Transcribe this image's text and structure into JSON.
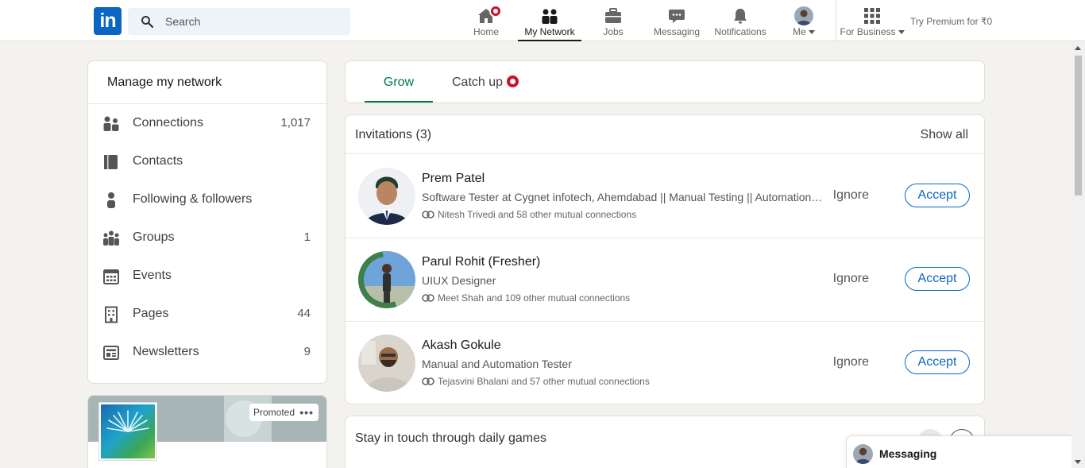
{
  "nav": {
    "logo": "in",
    "search_placeholder": "Search",
    "items": [
      {
        "label": "Home",
        "icon": "home-icon"
      },
      {
        "label": "My Network",
        "icon": "network-icon"
      },
      {
        "label": "Jobs",
        "icon": "briefcase-icon"
      },
      {
        "label": "Messaging",
        "icon": "chat-icon"
      },
      {
        "label": "Notifications",
        "icon": "bell-icon"
      },
      {
        "label": "Me",
        "icon": "avatar"
      },
      {
        "label": "For Business",
        "icon": "grid-icon"
      }
    ],
    "active": "My Network",
    "premium": "Try Premium for ₹0"
  },
  "network": {
    "title": "Manage my network",
    "items": [
      {
        "label": "Connections",
        "count": "1,017",
        "icon": "people-icon"
      },
      {
        "label": "Contacts",
        "count": "",
        "icon": "address-book-icon"
      },
      {
        "label": "Following & followers",
        "count": "",
        "icon": "person-icon"
      },
      {
        "label": "Groups",
        "count": "1",
        "icon": "group-icon"
      },
      {
        "label": "Events",
        "count": "",
        "icon": "calendar-icon"
      },
      {
        "label": "Pages",
        "count": "44",
        "icon": "building-icon"
      },
      {
        "label": "Newsletters",
        "count": "9",
        "icon": "newspaper-icon"
      }
    ]
  },
  "promo": {
    "tag": "Promoted",
    "more": "•••"
  },
  "tabs": [
    {
      "label": "Grow",
      "active": true
    },
    {
      "label": "Catch up",
      "active": false
    }
  ],
  "invitations": {
    "title": "Invitations (3)",
    "show_all": "Show all",
    "ignore_label": "Ignore",
    "accept_label": "Accept",
    "items": [
      {
        "name": "Prem Patel",
        "headline": "Software Tester at Cygnet infotech, Ahemdabad || Manual Testing || Automation Testing",
        "mutual": "Nitesh Trivedi and 58 other mutual connections"
      },
      {
        "name": "Parul Rohit (Fresher)",
        "headline": "UIUX Designer",
        "mutual": "Meet Shah and 109 other mutual connections"
      },
      {
        "name": "Akash Gokule",
        "headline": "Manual and Automation Tester",
        "mutual": "Tejasvini Bhalani and 57 other mutual connections"
      }
    ]
  },
  "games": {
    "title": "Stay in touch through daily games"
  },
  "messaging": {
    "label": "Messaging"
  },
  "colors": {
    "brand": "#0a66c2",
    "active_tab": "#01754f",
    "badge": "#cb112d",
    "background": "#f4f2ee"
  }
}
